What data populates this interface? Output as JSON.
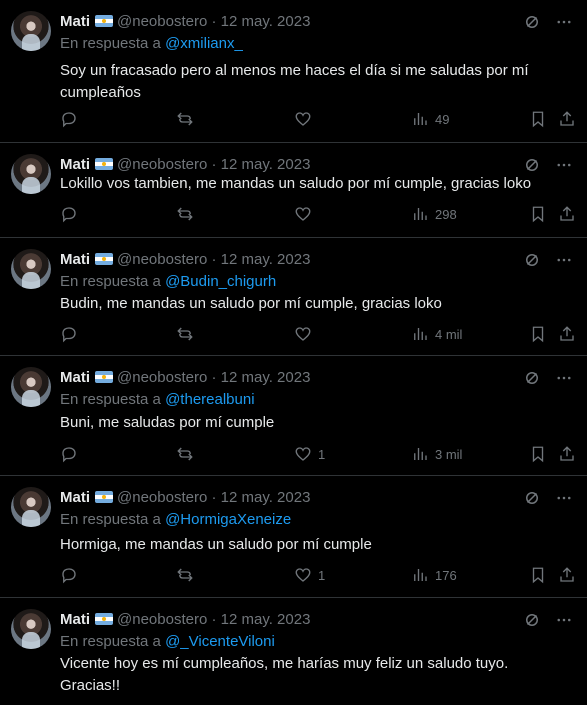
{
  "tweets": [
    {
      "name": "Mati",
      "handle": "@neobostero",
      "date": "· 12 may. 2023",
      "reply_prefix": "En respuesta a",
      "reply_to": "@xmilianx_",
      "text": "Soy un fracasado pero al menos me haces el día si me saludas por mí cumpleaños",
      "likes": "",
      "views": "49"
    },
    {
      "name": "Mati",
      "handle": "@neobostero",
      "date": "· 12 may. 2023",
      "reply_prefix": "",
      "reply_to": "",
      "text": "Lokillo vos tambien, me mandas un saludo por mí cumple, gracias loko",
      "likes": "",
      "views": "298"
    },
    {
      "name": "Mati",
      "handle": "@neobostero",
      "date": "· 12 may. 2023",
      "reply_prefix": "En respuesta a",
      "reply_to": "@Budin_chigurh",
      "text": "Budin, me mandas un saludo por mí cumple, gracias loko",
      "likes": "",
      "views": "4 mil"
    },
    {
      "name": "Mati",
      "handle": "@neobostero",
      "date": "· 12 may. 2023",
      "reply_prefix": "En respuesta a",
      "reply_to": "@therealbuni",
      "text": "Buni, me saludas por mí cumple",
      "likes": "1",
      "views": "3 mil"
    },
    {
      "name": "Mati",
      "handle": "@neobostero",
      "date": "· 12 may. 2023",
      "reply_prefix": "En respuesta a",
      "reply_to": "@HormigaXeneize",
      "text": "Hormiga, me mandas un saludo por mí cumple",
      "likes": "1",
      "views": "176"
    },
    {
      "name": "Mati",
      "handle": "@neobostero",
      "date": "· 12 may. 2023",
      "reply_prefix": "En respuesta a",
      "reply_to": "@_VicenteViloni",
      "text": "Vicente hoy es mí cumpleaños, me harías muy feliz un saludo tuyo. Gracias!!",
      "likes": "",
      "views": ""
    }
  ],
  "icons": {
    "reply": "reply-icon",
    "retweet": "retweet-icon",
    "like": "heart-icon",
    "views": "views-icon",
    "bookmark": "bookmark-icon",
    "share": "share-icon",
    "grok": "grok-icon",
    "more": "more-icon"
  },
  "colors": {
    "background": "#000000",
    "text": "#e7e9ea",
    "muted": "#71767b",
    "link": "#1d9bf0",
    "divider": "#2f3336"
  }
}
